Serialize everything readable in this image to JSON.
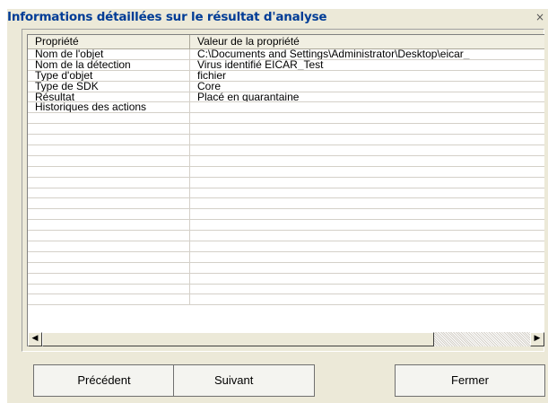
{
  "window": {
    "title": "Informations détaillées sur le résultat d'analyse",
    "close_glyph": "×"
  },
  "table": {
    "columns": [
      "Propriété",
      "Valeur de la propriété"
    ],
    "rows": [
      [
        "Nom de l'objet",
        "C:\\Documents and Settings\\Administrator\\Desktop\\eicar_"
      ],
      [
        "Nom de la détection",
        "Virus identifié EICAR_Test"
      ],
      [
        "Type d'objet",
        "fichier"
      ],
      [
        "Type de SDK",
        "Core"
      ],
      [
        "Résultat",
        "Placé en quarantaine"
      ],
      [
        "Historiques des actions",
        ""
      ],
      [
        "",
        ""
      ],
      [
        "",
        ""
      ],
      [
        "",
        ""
      ],
      [
        "",
        ""
      ],
      [
        "",
        ""
      ],
      [
        "",
        ""
      ],
      [
        "",
        ""
      ],
      [
        "",
        ""
      ],
      [
        "",
        ""
      ],
      [
        "",
        ""
      ],
      [
        "",
        ""
      ],
      [
        "",
        ""
      ],
      [
        "",
        ""
      ],
      [
        "",
        ""
      ],
      [
        "",
        ""
      ],
      [
        "",
        ""
      ],
      [
        "",
        ""
      ],
      [
        "",
        ""
      ]
    ]
  },
  "scrollbar": {
    "left_arrow": "◀",
    "right_arrow": "▶"
  },
  "buttons": {
    "previous": "Précédent",
    "next": "Suivant",
    "close": "Fermer"
  },
  "colors": {
    "title_text": "#003c96",
    "dialog_bg": "#ece9d8"
  }
}
